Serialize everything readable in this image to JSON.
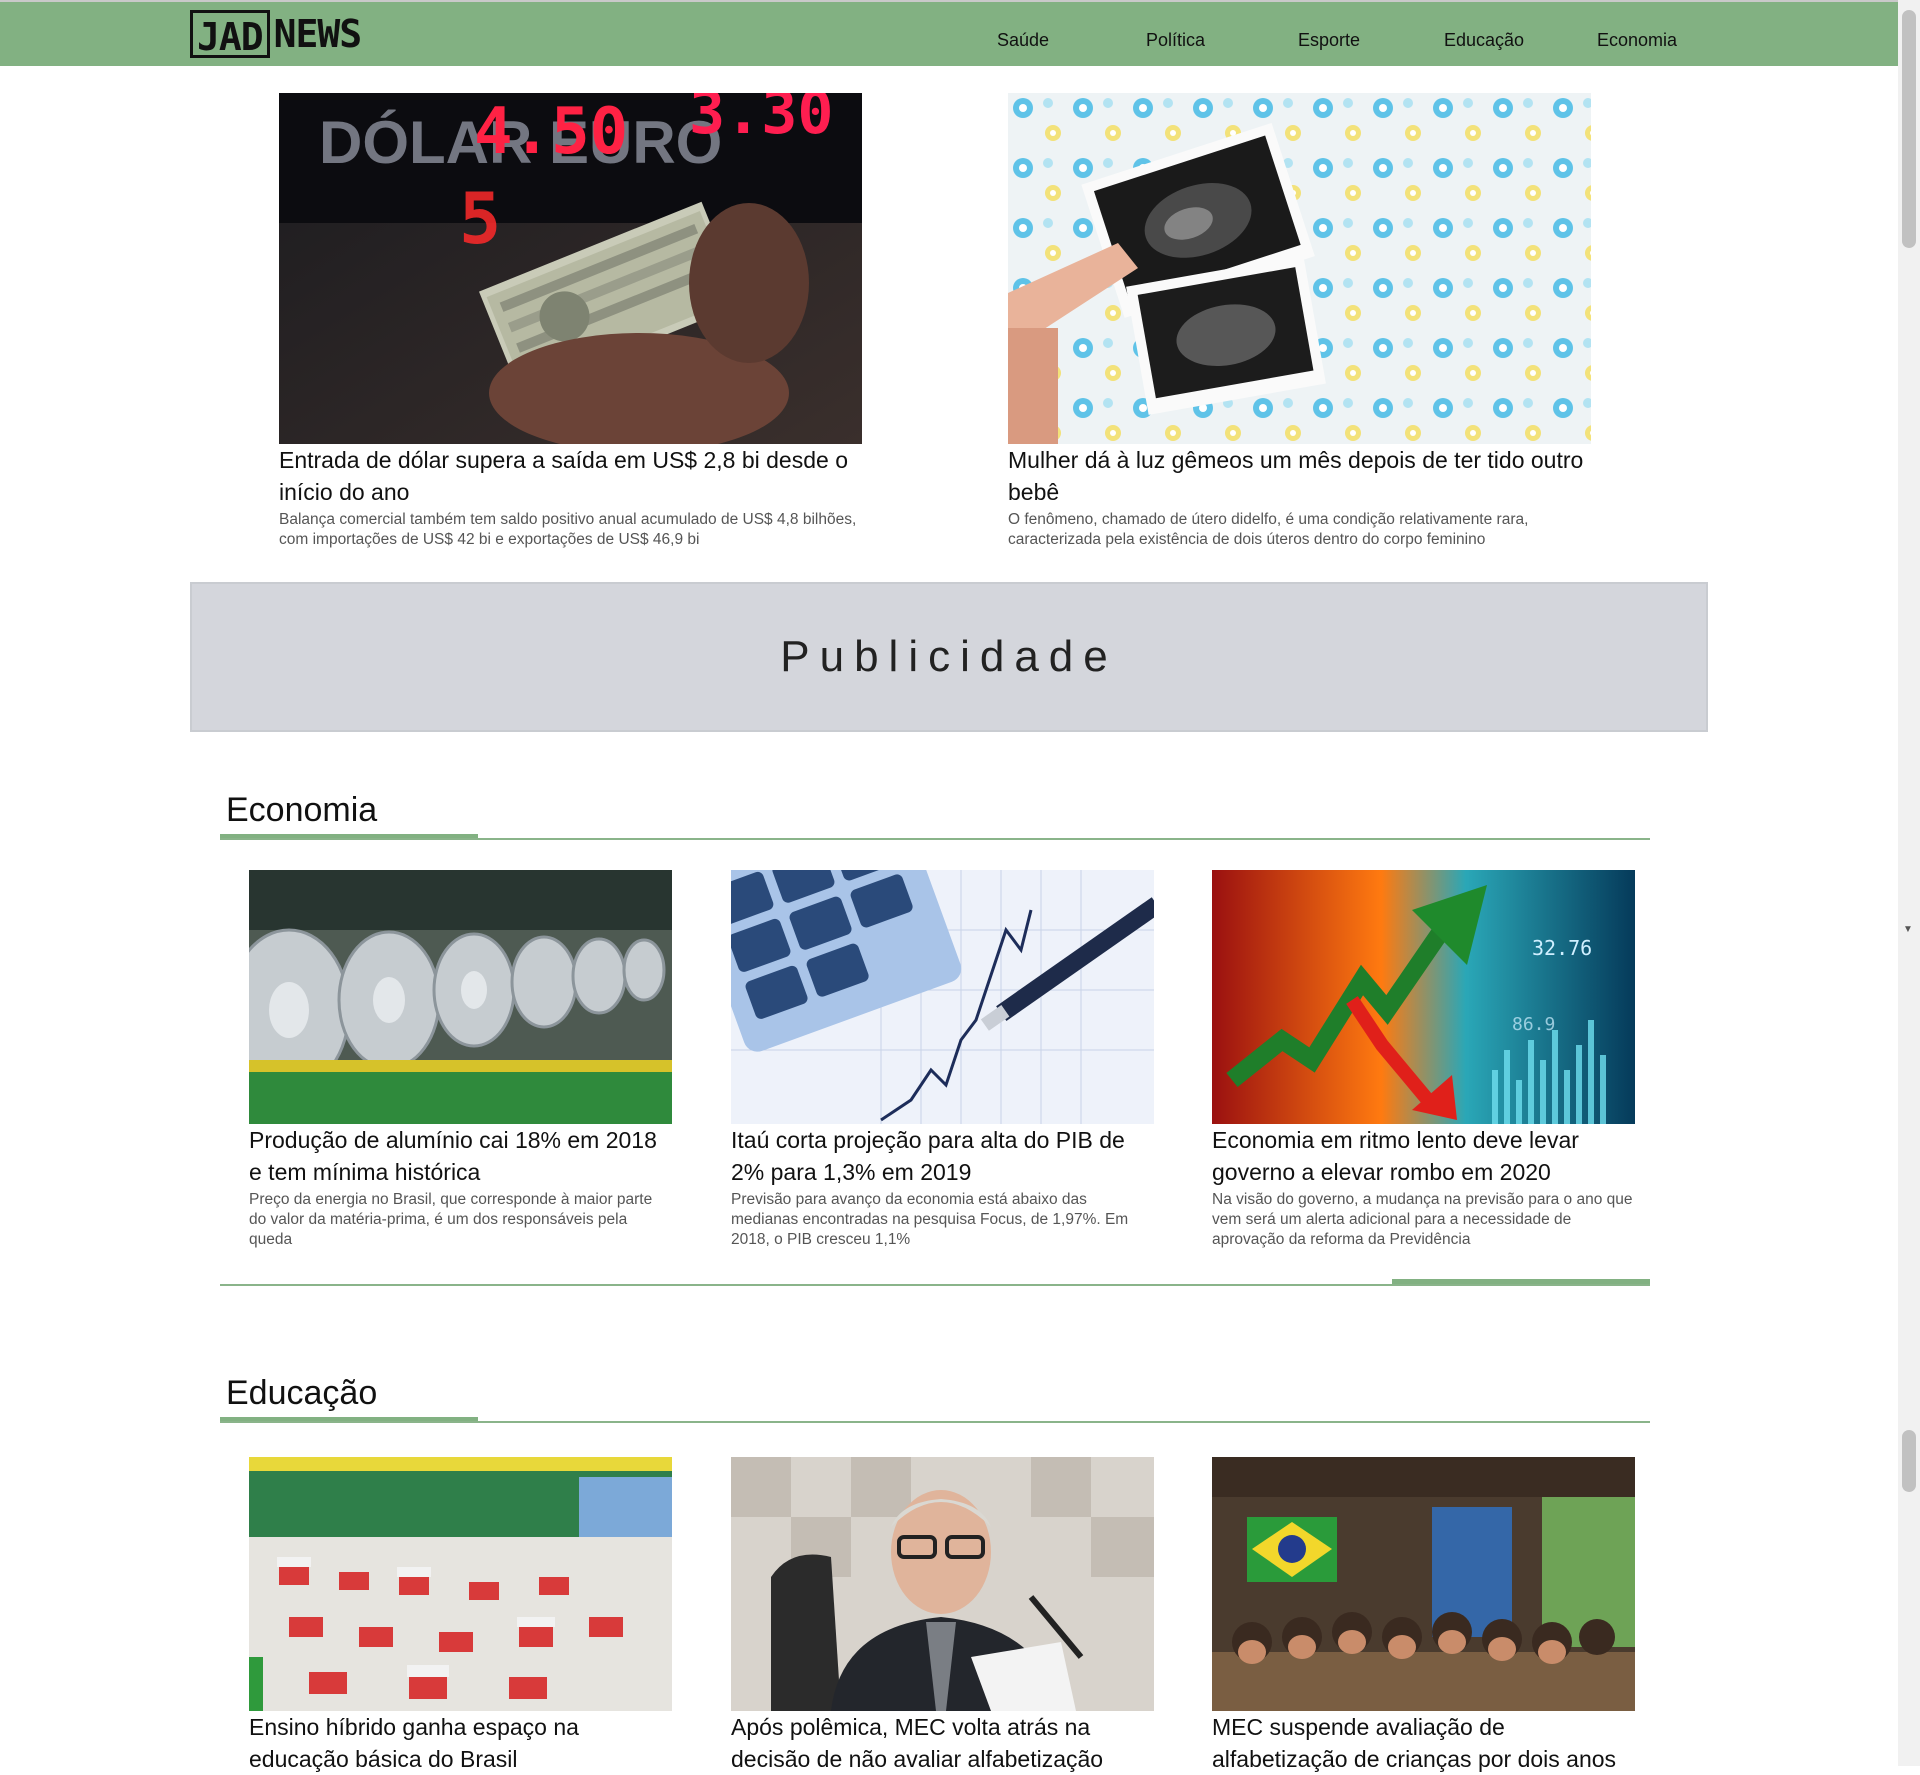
{
  "brand": {
    "logo_boxed": "JAD",
    "logo_rest": "NEWS"
  },
  "nav": [
    "Saúde",
    "Política",
    "Esporte",
    "Educação",
    "Economia"
  ],
  "hero": [
    {
      "title": "Entrada de dólar supera a saída em US$ 2,8 bi desde o início do ano",
      "desc": "Balança comercial também tem saldo positivo anual acumulado de US$ 4,8 bilhões, com importações de US$ 42 bi e exportações de US$ 46,9 bi",
      "image": "DÓLAR EURO"
    },
    {
      "title": "Mulher dá à luz gêmeos um mês depois de ter tido outro bebê",
      "desc": "O fenômeno, chamado de útero didelfo, é uma condição relativamente rara, caracterizada pela existência de dois úteros dentro do corpo feminino"
    }
  ],
  "ad": {
    "label": "Publicidade"
  },
  "sections": [
    {
      "heading": "Economia",
      "cards": [
        {
          "title": "Produção de alumínio cai 18% em 2018 e tem mínima histórica",
          "desc": "Preço da energia no Brasil, que corresponde à maior parte do valor da matéria-prima, é um dos responsáveis pela queda"
        },
        {
          "title": "Itaú corta projeção para alta do PIB de 2% para 1,3% em 2019",
          "desc": "Previsão para avanço da economia está abaixo das medianas encontradas na pesquisa Focus, de 1,97%. Em 2018, o PIB cresceu 1,1%"
        },
        {
          "title": "Economia em ritmo lento deve levar governo a elevar rombo em 2020",
          "desc": "Na visão do governo, a mudança na previsão para o ano que vem será um alerta adicional para a necessidade de aprovação da reforma da Previdência"
        }
      ]
    },
    {
      "heading": "Educação",
      "cards": [
        {
          "title": "Ensino híbrido ganha espaço na educação básica do Brasil"
        },
        {
          "title": "Após polêmica, MEC volta atrás na decisão de não avaliar alfabetização"
        },
        {
          "title": "MEC suspende avaliação de alfabetização de crianças por dois anos"
        }
      ]
    }
  ],
  "colors": {
    "header_green": "#82b182",
    "ad_gray": "#d4d6dc",
    "rule_green": "#8ab48a"
  }
}
